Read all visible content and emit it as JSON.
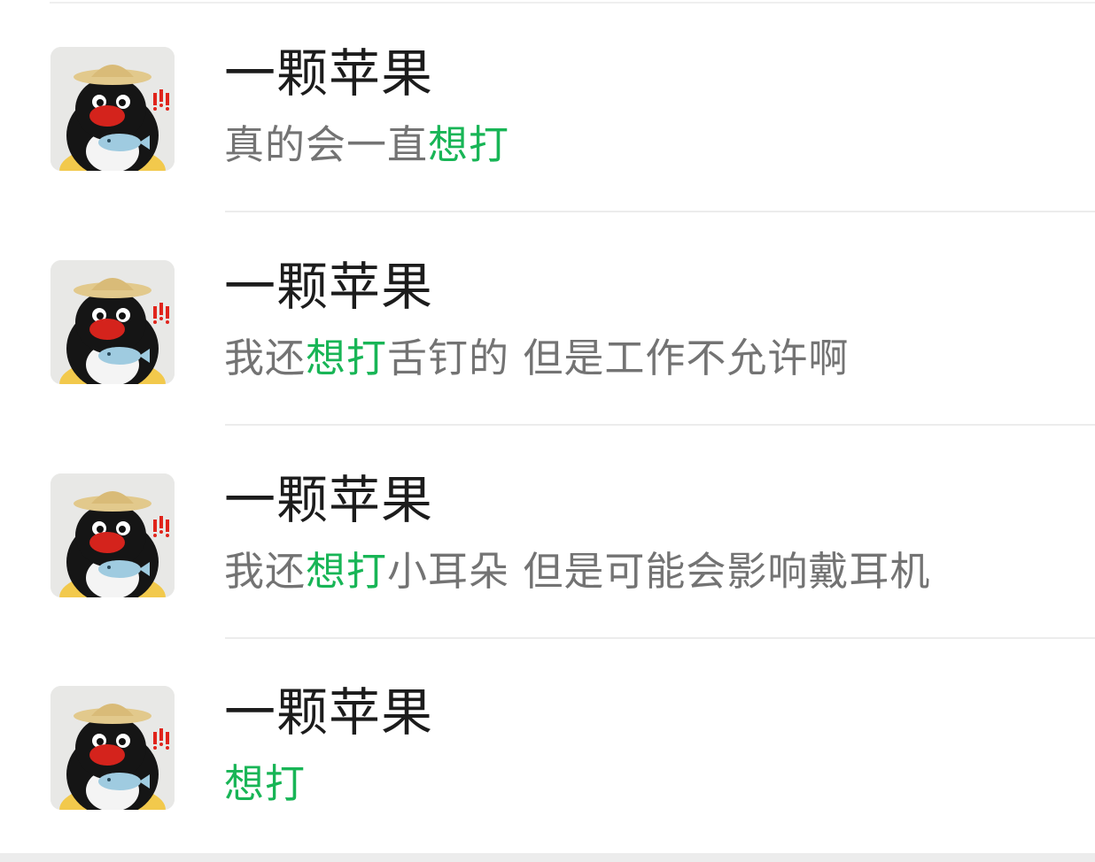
{
  "colors": {
    "highlight": "#18b556",
    "name_text": "#1c1c1c",
    "message_text": "#737373",
    "divider": "#ececec"
  },
  "avatar_icon": "penguin-with-straw-hat-avatar",
  "messages": [
    {
      "name": "一颗苹果",
      "parts": [
        {
          "text": "真的会一直",
          "highlight": false
        },
        {
          "text": "想打",
          "highlight": true
        }
      ]
    },
    {
      "name": "一颗苹果",
      "parts": [
        {
          "text": "我还",
          "highlight": false
        },
        {
          "text": "想打",
          "highlight": true
        },
        {
          "text": "舌钉的 但是工作不允许啊",
          "highlight": false
        }
      ]
    },
    {
      "name": "一颗苹果",
      "parts": [
        {
          "text": "我还",
          "highlight": false
        },
        {
          "text": "想打",
          "highlight": true
        },
        {
          "text": "小耳朵 但是可能会影响戴耳机",
          "highlight": false
        }
      ]
    },
    {
      "name": "一颗苹果",
      "parts": [
        {
          "text": "想打",
          "highlight": true
        }
      ]
    }
  ]
}
